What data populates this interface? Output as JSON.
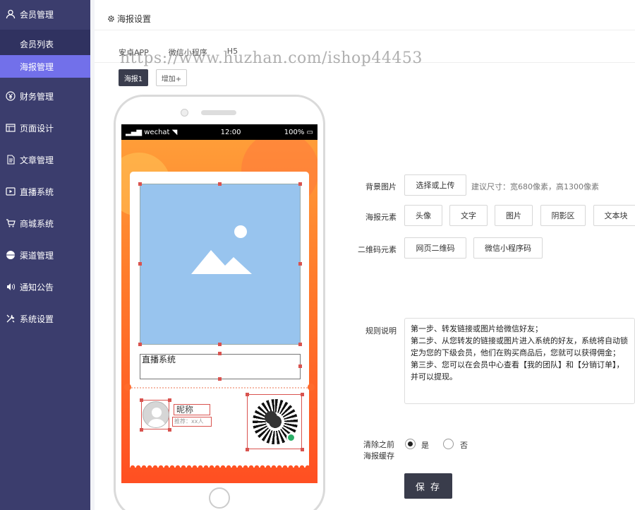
{
  "sidebar": {
    "header": "会员管理",
    "sub_items": [
      {
        "label": "会员列表",
        "active": false
      },
      {
        "label": "海报管理",
        "active": true
      }
    ],
    "items": [
      {
        "label": "财务管理",
        "icon": "yen-icon"
      },
      {
        "label": "页面设计",
        "icon": "layout-icon"
      },
      {
        "label": "文章管理",
        "icon": "document-icon"
      },
      {
        "label": "直播系统",
        "icon": "play-icon"
      },
      {
        "label": "商城系统",
        "icon": "cart-icon"
      },
      {
        "label": "渠道管理",
        "icon": "globe-icon"
      },
      {
        "label": "通知公告",
        "icon": "speaker-icon"
      },
      {
        "label": "系统设置",
        "icon": "tools-icon"
      }
    ]
  },
  "panel": {
    "title": "海报设置",
    "tabs": [
      "安卓APP",
      "微信小程序",
      "H5"
    ],
    "watermark": "https://www.huzhan.com/ishop44453",
    "poster_tab": "海报1",
    "add_button": "增加+"
  },
  "phone": {
    "carrier": "wechat",
    "time": "12:00",
    "battery": "100%",
    "text_element": "直播系统",
    "nickname": "昵称",
    "recommend": "推荐：xx人"
  },
  "form": {
    "bg_label": "背景图片",
    "bg_button": "选择或上传",
    "bg_hint": "建议尺寸：宽680像素，高1300像素",
    "elements_label": "海报元素",
    "elements": [
      "头像",
      "文字",
      "图片",
      "阴影区",
      "文本块"
    ],
    "qr_label": "二维码元素",
    "qr_buttons": [
      "网页二维码",
      "微信小程序码"
    ],
    "rules_label": "规则说明",
    "rules_text": "第一步、转发链接或图片给微信好友；\n第二步、从您转发的链接或图片进入系统的好友，系统将自动锁定为您的下级会员，他们在购买商品后，您就可以获得佣金；\n第三步、您可以在会员中心查看【我的团队】和【分销订单】，并可以提现。",
    "clear_label_1": "清除之前",
    "clear_label_2": "海报缓存",
    "yes": "是",
    "no": "否",
    "save": "保 存"
  }
}
